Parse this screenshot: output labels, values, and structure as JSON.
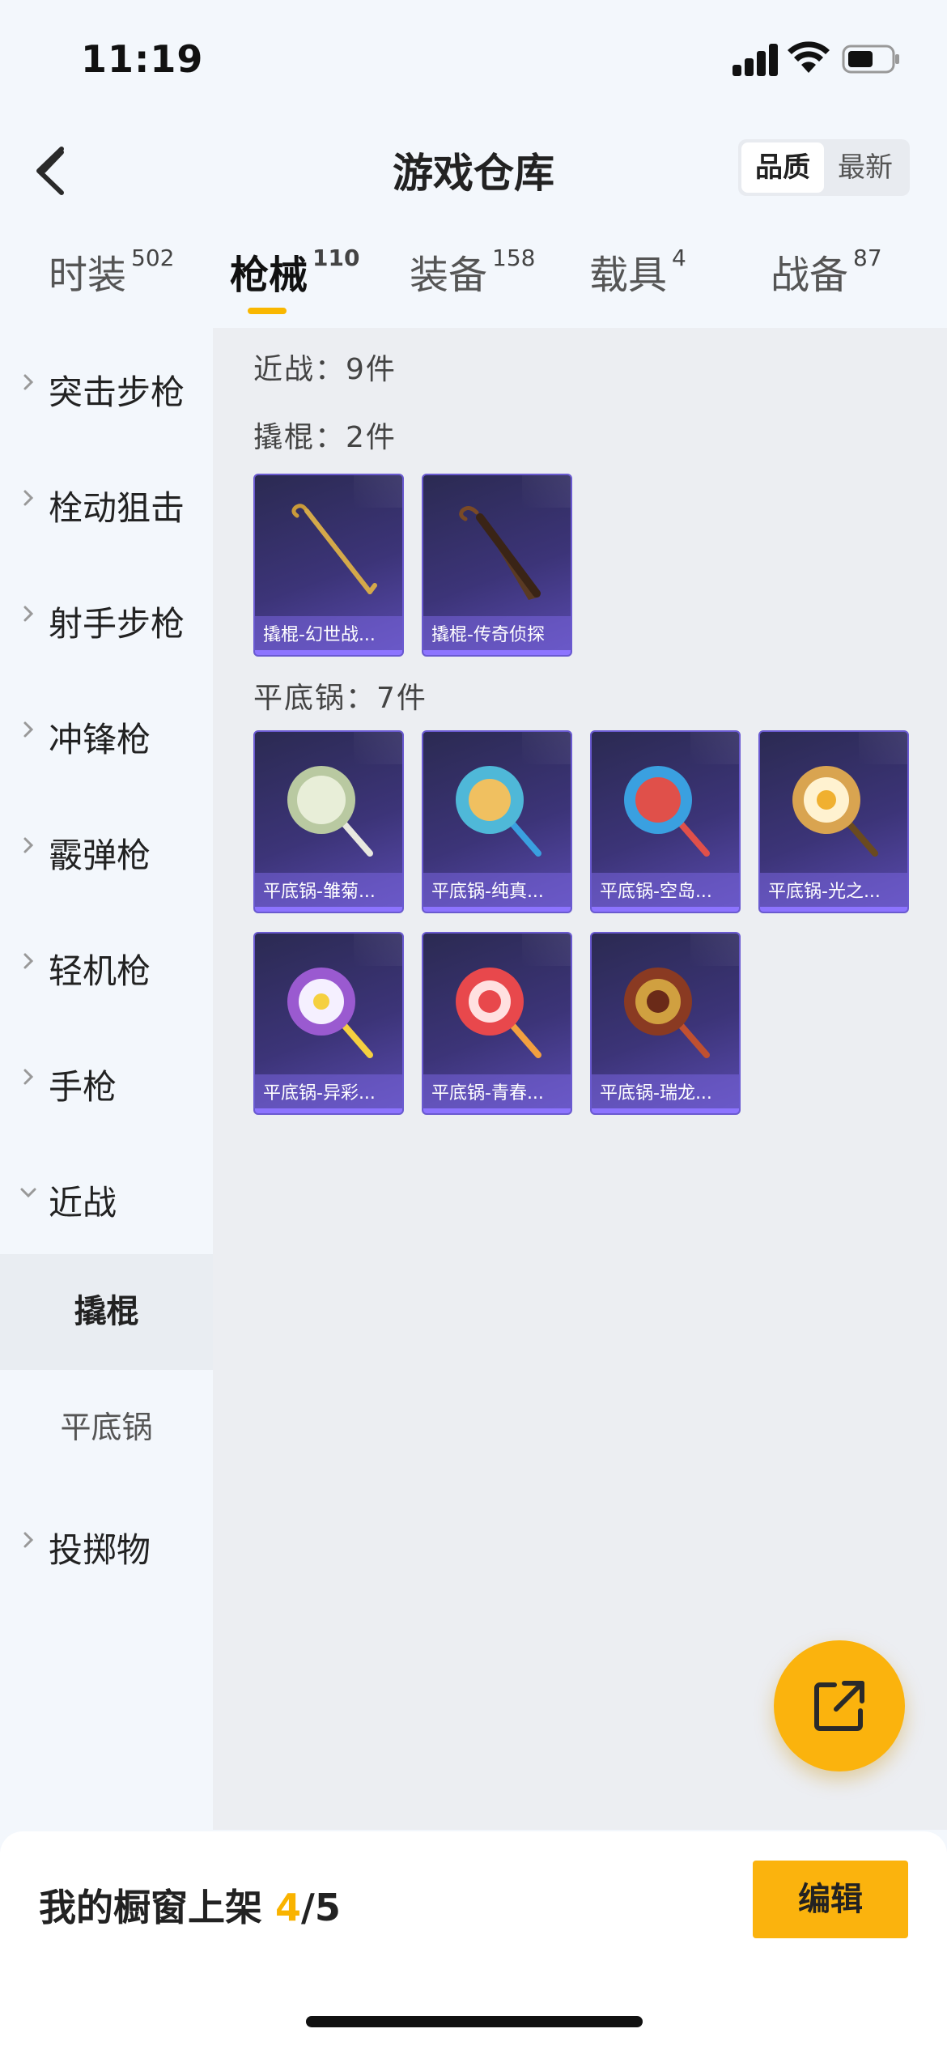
{
  "status_bar": {
    "time": "11:19"
  },
  "header": {
    "title": "游戏仓库",
    "sort_options": [
      {
        "label": "品质",
        "active": true
      },
      {
        "label": "最新",
        "active": false
      }
    ]
  },
  "tabs": [
    {
      "label": "时装",
      "count": "502",
      "active": false
    },
    {
      "label": "枪械",
      "count": "110",
      "active": true
    },
    {
      "label": "装备",
      "count": "158",
      "active": false
    },
    {
      "label": "载具",
      "count": "4",
      "active": false
    },
    {
      "label": "战备",
      "count": "87",
      "active": false
    }
  ],
  "sidebar": {
    "items": [
      {
        "label": "突击步枪",
        "expanded": false
      },
      {
        "label": "栓动狙击",
        "expanded": false
      },
      {
        "label": "射手步枪",
        "expanded": false
      },
      {
        "label": "冲锋枪",
        "expanded": false
      },
      {
        "label": "霰弹枪",
        "expanded": false
      },
      {
        "label": "轻机枪",
        "expanded": false
      },
      {
        "label": "手枪",
        "expanded": false
      },
      {
        "label": "近战",
        "expanded": true
      },
      {
        "label": "投掷物",
        "expanded": false
      }
    ],
    "subitems": [
      {
        "label": "撬棍",
        "active": true
      },
      {
        "label": "平底锅",
        "active": false
      }
    ]
  },
  "content": {
    "melee_summary": "近战：9件",
    "groups": [
      {
        "label": "撬棍：2件",
        "items": [
          {
            "name": "撬棍-幻世战...",
            "art": "crowbar"
          },
          {
            "name": "撬棍-传奇侦探",
            "art": "umbrella"
          }
        ]
      },
      {
        "label": "平底锅：7件",
        "items": [
          {
            "name": "平底锅-雏菊...",
            "art": "pan",
            "color": "#b9c9a1",
            "accent": "#e8eed8"
          },
          {
            "name": "平底锅-纯真...",
            "art": "pan",
            "color": "#4fb8d8",
            "accent": "#f0c060"
          },
          {
            "name": "平底锅-空岛...",
            "art": "pan",
            "color": "#e0504a",
            "accent": "#3aa0e0"
          },
          {
            "name": "平底锅-光之...",
            "art": "pan",
            "color": "#d9a450",
            "accent": "#fff2d0"
          },
          {
            "name": "平底锅-异彩...",
            "art": "pan",
            "color": "#9a5ad0",
            "accent": "#f5d040"
          },
          {
            "name": "平底锅-青春...",
            "art": "pan",
            "color": "#e8484c",
            "accent": "#ffe0e0"
          },
          {
            "name": "平底锅-瑞龙...",
            "art": "pan",
            "color": "#8a3a22",
            "accent": "#d0a040"
          }
        ]
      }
    ]
  },
  "bottom_bar": {
    "shelf_prefix": "我的橱窗上架 ",
    "shelf_current": "4",
    "shelf_total": "/5",
    "edit_label": "编辑"
  },
  "colors": {
    "accent": "#fbb30d",
    "card_border": "#6a5ad0",
    "tab_underline": "#f9b700"
  }
}
